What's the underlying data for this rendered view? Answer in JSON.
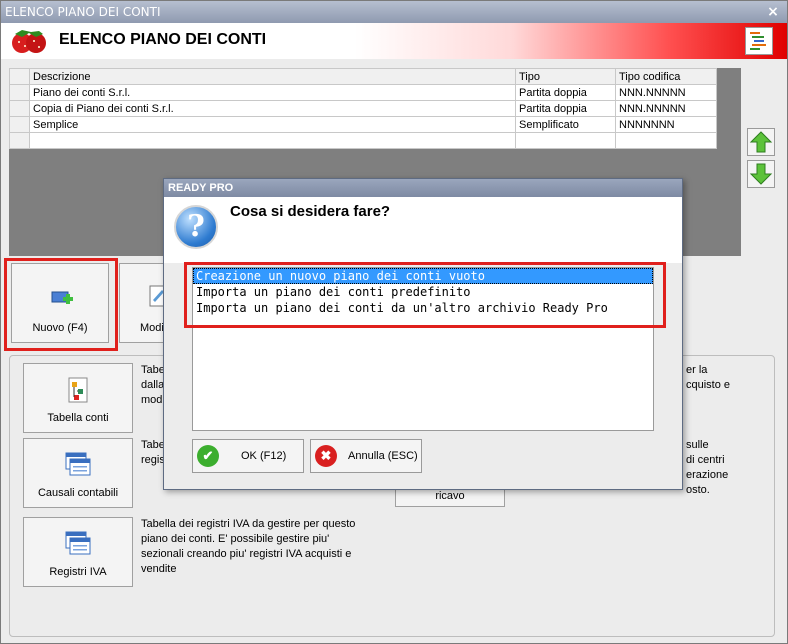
{
  "window": {
    "title": "ELENCO PIANO DEI CONTI",
    "close": "×"
  },
  "header": {
    "title": "ELENCO PIANO DEI CONTI"
  },
  "grid": {
    "columns": [
      "Descrizione",
      "Tipo",
      "Tipo codifica"
    ],
    "rows": [
      [
        "Piano dei conti S.r.l.",
        "Partita doppia",
        "NNN.NNNNN"
      ],
      [
        "Copia di Piano dei conti S.r.l.",
        "Partita doppia",
        "NNN.NNNNN"
      ],
      [
        "Semplice",
        "Semplificato",
        "NNNNNNN"
      ]
    ]
  },
  "actions": {
    "new": "Nuovo (F4)",
    "modify": "Modi"
  },
  "tools": [
    {
      "label": "Tabella conti",
      "desc": [
        "Tabe",
        "dalla",
        "modi"
      ],
      "desc_right": [
        "er la",
        "cquisto e"
      ]
    },
    {
      "label": "Causali contabili",
      "desc": [
        "Tabe",
        "regis"
      ],
      "desc_right": [
        "sulle",
        "di centri",
        "erazione",
        "osto."
      ]
    },
    {
      "label": "Registri IVA",
      "desc": [
        "Tabella dei registri IVA da gestire per questo",
        "piano dei conti. E' possibile gestire piu'",
        "sezionali creando piu' registri IVA acquisti e",
        "vendite"
      ]
    }
  ],
  "hidden_button_label": "ricavo",
  "dialog": {
    "title": "READY PRO",
    "question": "Cosa si desidera fare?",
    "options": [
      "Creazione un nuovo piano dei conti vuoto",
      "Importa un piano dei conti predefinito",
      "Importa un piano dei conti da un'altro archivio Ready Pro"
    ],
    "selected_index": 0,
    "ok": "OK (F12)",
    "cancel": "Annulla (ESC)"
  },
  "colors": {
    "highlight": "#e0201c",
    "selection": "#3399ff"
  }
}
